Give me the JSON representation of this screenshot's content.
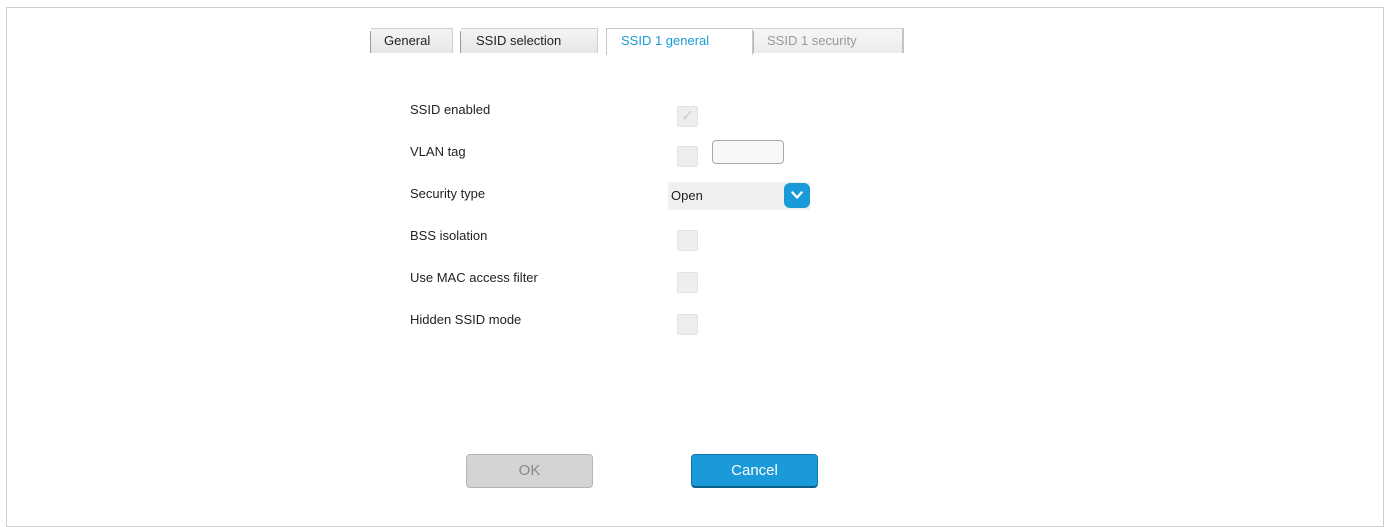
{
  "tabs": [
    {
      "label": "General",
      "state": "normal"
    },
    {
      "label": "SSID selection",
      "state": "normal"
    },
    {
      "label": "SSID 1 general",
      "state": "active"
    },
    {
      "label": "SSID 1 security",
      "state": "disabled"
    }
  ],
  "form": {
    "ssid_enabled": {
      "label": "SSID enabled",
      "checked": true,
      "disabled": true
    },
    "vlan_tag": {
      "label": "VLAN tag",
      "checked": false,
      "value": ""
    },
    "security_type": {
      "label": "Security type",
      "selected": "Open"
    },
    "bss_isolation": {
      "label": "BSS isolation",
      "checked": false
    },
    "mac_filter": {
      "label": "Use MAC access filter",
      "checked": false
    },
    "hidden_ssid": {
      "label": "Hidden SSID mode",
      "checked": false
    }
  },
  "buttons": {
    "ok_label": "OK",
    "cancel_label": "Cancel"
  },
  "colors": {
    "accent": "#1a9ad8",
    "active_tab_text": "#1a9bd7",
    "disabled_text": "#9a9a9a"
  },
  "icons": {
    "check": "checkmark-icon",
    "dropdown": "chevron-down-icon"
  }
}
